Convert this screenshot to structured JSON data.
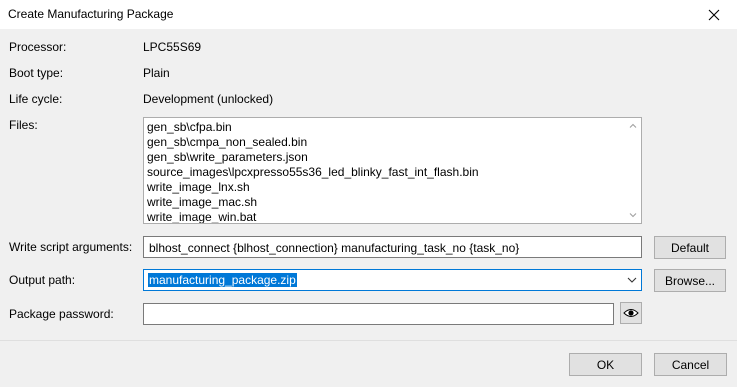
{
  "window": {
    "title": "Create Manufacturing Package",
    "close_icon": "close-icon"
  },
  "fields": {
    "processor_label": "Processor:",
    "processor_value": "LPC55S69",
    "boot_type_label": "Boot type:",
    "boot_type_value": "Plain",
    "life_cycle_label": "Life cycle:",
    "life_cycle_value": "Development (unlocked)",
    "files_label": "Files:",
    "files": [
      "gen_sb\\cfpa.bin",
      "gen_sb\\cmpa_non_sealed.bin",
      "gen_sb\\write_parameters.json",
      "source_images\\lpcxpresso55s36_led_blinky_fast_int_flash.bin",
      "write_image_lnx.sh",
      "write_image_mac.sh",
      "write_image_win.bat"
    ],
    "write_script_label": "Write script arguments:",
    "write_script_value": "blhost_connect {blhost_connection} manufacturing_task_no {task_no}",
    "output_path_label": "Output path:",
    "output_path_value": "manufacturing_package.zip",
    "package_password_label": "Package password:",
    "package_password_value": ""
  },
  "buttons": {
    "default": "Default",
    "browse": "Browse...",
    "ok": "OK",
    "cancel": "Cancel"
  },
  "icons": {
    "show_password": "eye-icon",
    "dropdown": "chevron-down-icon"
  },
  "colors": {
    "selection": "#0078d7",
    "focus_border": "#0078d7"
  }
}
